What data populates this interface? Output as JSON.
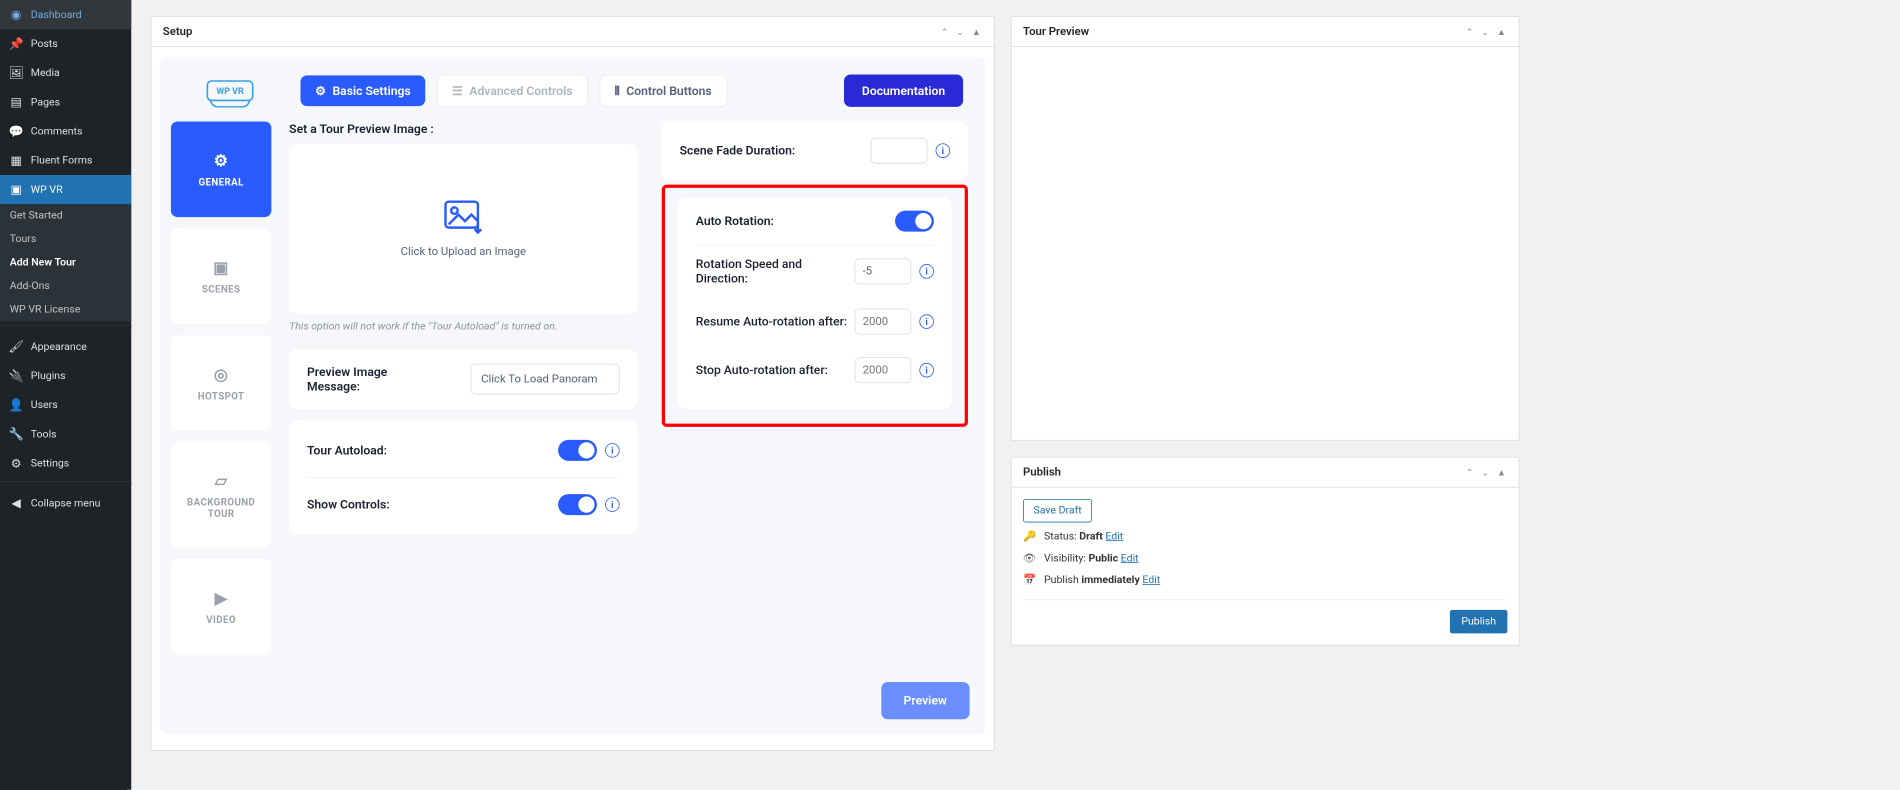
{
  "sidebar": {
    "items": [
      {
        "label": "Dashboard"
      },
      {
        "label": "Posts"
      },
      {
        "label": "Media"
      },
      {
        "label": "Pages"
      },
      {
        "label": "Comments"
      },
      {
        "label": "Fluent Forms"
      },
      {
        "label": "WP VR"
      }
    ],
    "sub": [
      {
        "label": "Get Started"
      },
      {
        "label": "Tours"
      },
      {
        "label": "Add New Tour"
      },
      {
        "label": "Add-Ons"
      },
      {
        "label": "WP VR License"
      }
    ],
    "items2": [
      {
        "label": "Appearance"
      },
      {
        "label": "Plugins"
      },
      {
        "label": "Users"
      },
      {
        "label": "Tools"
      },
      {
        "label": "Settings"
      }
    ],
    "collapse": "Collapse menu"
  },
  "setup": {
    "title": "Setup"
  },
  "tabs": {
    "basic": "Basic Settings",
    "advanced": "Advanced Controls",
    "control": "Control Buttons",
    "doc": "Documentation"
  },
  "vtabs": {
    "general": "GENERAL",
    "scenes": "SCENES",
    "hotspot": "HOTSPOT",
    "background": "BACKGROUND TOUR",
    "video": "VIDEO"
  },
  "logo": "WP VR",
  "left": {
    "setPreview": "Set a Tour Preview Image :",
    "uploadText": "Click to Upload an Image",
    "uploadHint": "This option will not work if the \"Tour Autoload\" is turned on.",
    "previewMsgLabel": "Preview Image Message:",
    "previewMsgValue": "Click To Load Panoram",
    "autoloadLabel": "Tour Autoload:",
    "showControlsLabel": "Show Controls:"
  },
  "right": {
    "fadeLabel": "Scene Fade Duration:",
    "fadeValue": "",
    "autoRotLabel": "Auto Rotation:",
    "speedLabel": "Rotation Speed and Direction:",
    "speedValue": "-5",
    "resumeLabel": "Resume Auto-rotation after:",
    "resumePlaceholder": "2000",
    "stopLabel": "Stop Auto-rotation after:",
    "stopPlaceholder": "2000"
  },
  "previewBtn": "Preview",
  "tourPreview": {
    "title": "Tour Preview"
  },
  "publish": {
    "title": "Publish",
    "saveDraft": "Save Draft",
    "statusLabel": "Status: ",
    "statusValue": "Draft",
    "visibilityLabel": "Visibility: ",
    "visibilityValue": "Public",
    "publishLabel": "Publish ",
    "publishValue": "immediately",
    "edit": "Edit",
    "publishBtn": "Publish"
  }
}
